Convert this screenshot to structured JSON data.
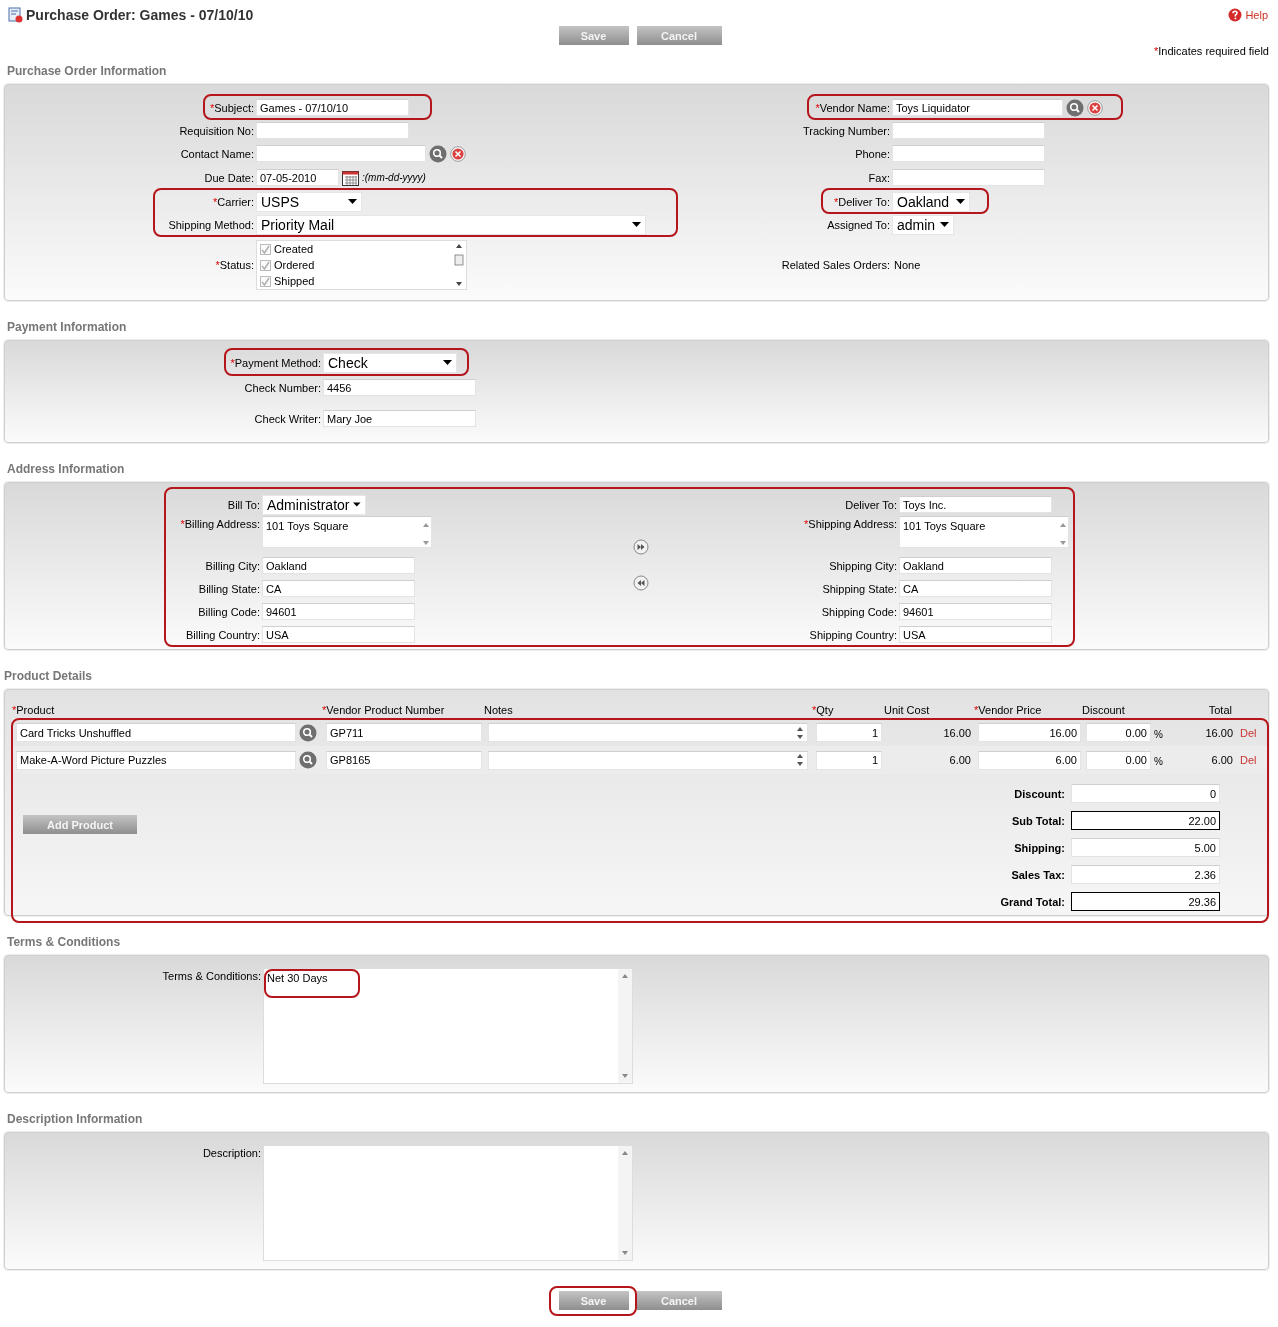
{
  "header": {
    "title": "Purchase Order: Games - 07/10/10",
    "help": "Help",
    "note_mark": "*",
    "note": "Indicates required field"
  },
  "top_buttons": [
    {
      "label": "Save"
    },
    {
      "label": "Cancel"
    }
  ],
  "sections": [
    {
      "kind": "po",
      "heading": "Purchase Order Information",
      "columns": [
        {
          "groups": [
            {
              "highlighted": true,
              "rows": [
                {
                  "kind": "text",
                  "label": "Subject:",
                  "mark": "*",
                  "value": "Games - 07/10/10"
                }
              ]
            },
            {
              "rows": [
                {
                  "kind": "text",
                  "label": "Requisition No:"
                },
                {
                  "kind": "lookup",
                  "label": "Contact Name:"
                },
                {
                  "kind": "date",
                  "label": "Due Date:",
                  "value": "07-05-2010",
                  "hint": ":(mm-dd-yyyy)"
                }
              ]
            },
            {
              "highlighted": true,
              "rows": [
                {
                  "kind": "select",
                  "label": "Carrier:",
                  "mark": "*",
                  "value": "USPS"
                },
                {
                  "kind": "select",
                  "label": "Shipping Method:",
                  "value": "Priority Mail"
                }
              ]
            },
            {
              "rows": [
                {
                  "kind": "checklist",
                  "label": "Status:",
                  "mark": "*",
                  "items": [
                    {
                      "label": "Created",
                      "checked": true
                    },
                    {
                      "label": "Ordered",
                      "checked": true
                    },
                    {
                      "label": "Shipped",
                      "checked": true
                    }
                  ]
                }
              ]
            }
          ]
        },
        {
          "groups": [
            {
              "highlighted": true,
              "rows": [
                {
                  "kind": "lookup",
                  "label": "Vendor Name:",
                  "mark": "*",
                  "value": "Toys Liquidator"
                }
              ]
            },
            {
              "rows": [
                {
                  "kind": "text",
                  "label": "Tracking Number:"
                },
                {
                  "kind": "text",
                  "label": "Phone:"
                },
                {
                  "kind": "text",
                  "label": "Fax:"
                }
              ]
            },
            {
              "highlighted": true,
              "rows": [
                {
                  "kind": "select",
                  "label": "Deliver To:",
                  "mark": "*",
                  "value": "Oakland"
                }
              ]
            },
            {
              "rows": [
                {
                  "kind": "select",
                  "label": "Assigned To:",
                  "value": "admin"
                },
                {
                  "kind": "static",
                  "label": "Related Sales Orders:",
                  "value": "None"
                }
              ]
            }
          ]
        }
      ]
    },
    {
      "kind": "payment",
      "heading": "Payment Information",
      "columns": [
        {
          "groups": [
            {
              "highlighted": true,
              "rows": [
                {
                  "kind": "select",
                  "label": "Payment Method:",
                  "mark": "*",
                  "value": "Check"
                }
              ]
            },
            {
              "rows": [
                {
                  "kind": "text",
                  "label": "Check Number:",
                  "value": "4456"
                },
                {
                  "kind": "text",
                  "label": "Check Writer:",
                  "value": "Mary Joe"
                }
              ]
            }
          ]
        }
      ]
    },
    {
      "kind": "address",
      "heading": "Address Information",
      "highlighted": true,
      "columns": [
        {
          "groups": [
            {
              "rows": [
                {
                  "kind": "select",
                  "label": "Bill To:",
                  "value": "Administrator"
                },
                {
                  "kind": "textarea",
                  "label": "Billing Address:",
                  "mark": "*",
                  "value": "101 Toys Square"
                },
                {
                  "kind": "text",
                  "label": "Billing City:",
                  "value": "Oakland"
                },
                {
                  "kind": "text",
                  "label": "Billing State:",
                  "value": "CA"
                },
                {
                  "kind": "text",
                  "label": "Billing Code:",
                  "value": "94601"
                },
                {
                  "kind": "text",
                  "label": "Billing Country:",
                  "value": "USA"
                }
              ]
            }
          ]
        },
        {
          "groups": [
            {
              "rows": [
                {
                  "kind": "text",
                  "label": "Deliver To:",
                  "value": "Toys Inc."
                },
                {
                  "kind": "textarea",
                  "label": "Shipping Address:",
                  "mark": "*",
                  "value": "101 Toys Square"
                },
                {
                  "kind": "text",
                  "label": "Shipping City:",
                  "value": "Oakland"
                },
                {
                  "kind": "text",
                  "label": "Shipping State:",
                  "value": "CA"
                },
                {
                  "kind": "text",
                  "label": "Shipping Code:",
                  "value": "94601"
                },
                {
                  "kind": "text",
                  "label": "Shipping Country:",
                  "value": "USA"
                }
              ]
            }
          ]
        }
      ]
    },
    {
      "kind": "products",
      "heading": "Product Details",
      "highlighted": true,
      "columns": [
        {
          "label": "Product",
          "mark": "*"
        },
        {
          "label": "Vendor Product Number",
          "mark": "*"
        },
        {
          "label": "Notes"
        },
        {
          "label": "Qty",
          "mark": "*"
        },
        {
          "label": "Unit Cost"
        },
        {
          "label": "Vendor Price",
          "mark": "*"
        },
        {
          "label": "Discount"
        },
        {
          "label": "Total"
        }
      ],
      "rows": [
        {
          "product": "Card Tricks Unshuffled",
          "vendor_product_number": "GP711",
          "qty": "1",
          "unit_cost": "16.00",
          "vendor_price": "16.00",
          "discount": "0.00",
          "percent": "%",
          "total": "16.00",
          "delete": "Del"
        },
        {
          "product": "Make-A-Word Picture Puzzles",
          "vendor_product_number": "GP8165",
          "qty": "1",
          "unit_cost": "6.00",
          "vendor_price": "6.00",
          "discount": "0.00",
          "percent": "%",
          "total": "6.00",
          "delete": "Del"
        }
      ],
      "add_button": "Add Product",
      "totals": [
        {
          "label": "Discount:",
          "value": "0",
          "emphasized": false
        },
        {
          "label": "Sub Total:",
          "value": "22.00",
          "emphasized": true
        },
        {
          "label": "Shipping:",
          "value": "5.00",
          "emphasized": false
        },
        {
          "label": "Sales Tax:",
          "value": "2.36",
          "emphasized": false
        },
        {
          "label": "Grand Total:",
          "value": "29.36",
          "emphasized": true
        }
      ]
    },
    {
      "kind": "terms",
      "heading": "Terms & Conditions",
      "columns": [
        {
          "groups": [
            {
              "rows": [
                {
                  "kind": "largearea",
                  "label": "Terms & Conditions:",
                  "value": "Net 30 Days",
                  "value_highlighted": true
                }
              ]
            }
          ]
        }
      ]
    },
    {
      "kind": "description",
      "heading": "Description Information",
      "columns": [
        {
          "groups": [
            {
              "rows": [
                {
                  "kind": "largearea",
                  "label": "Description:"
                }
              ]
            }
          ]
        }
      ]
    }
  ],
  "bottom_buttons": [
    {
      "label": "Save",
      "highlighted": true
    },
    {
      "label": "Cancel"
    }
  ]
}
